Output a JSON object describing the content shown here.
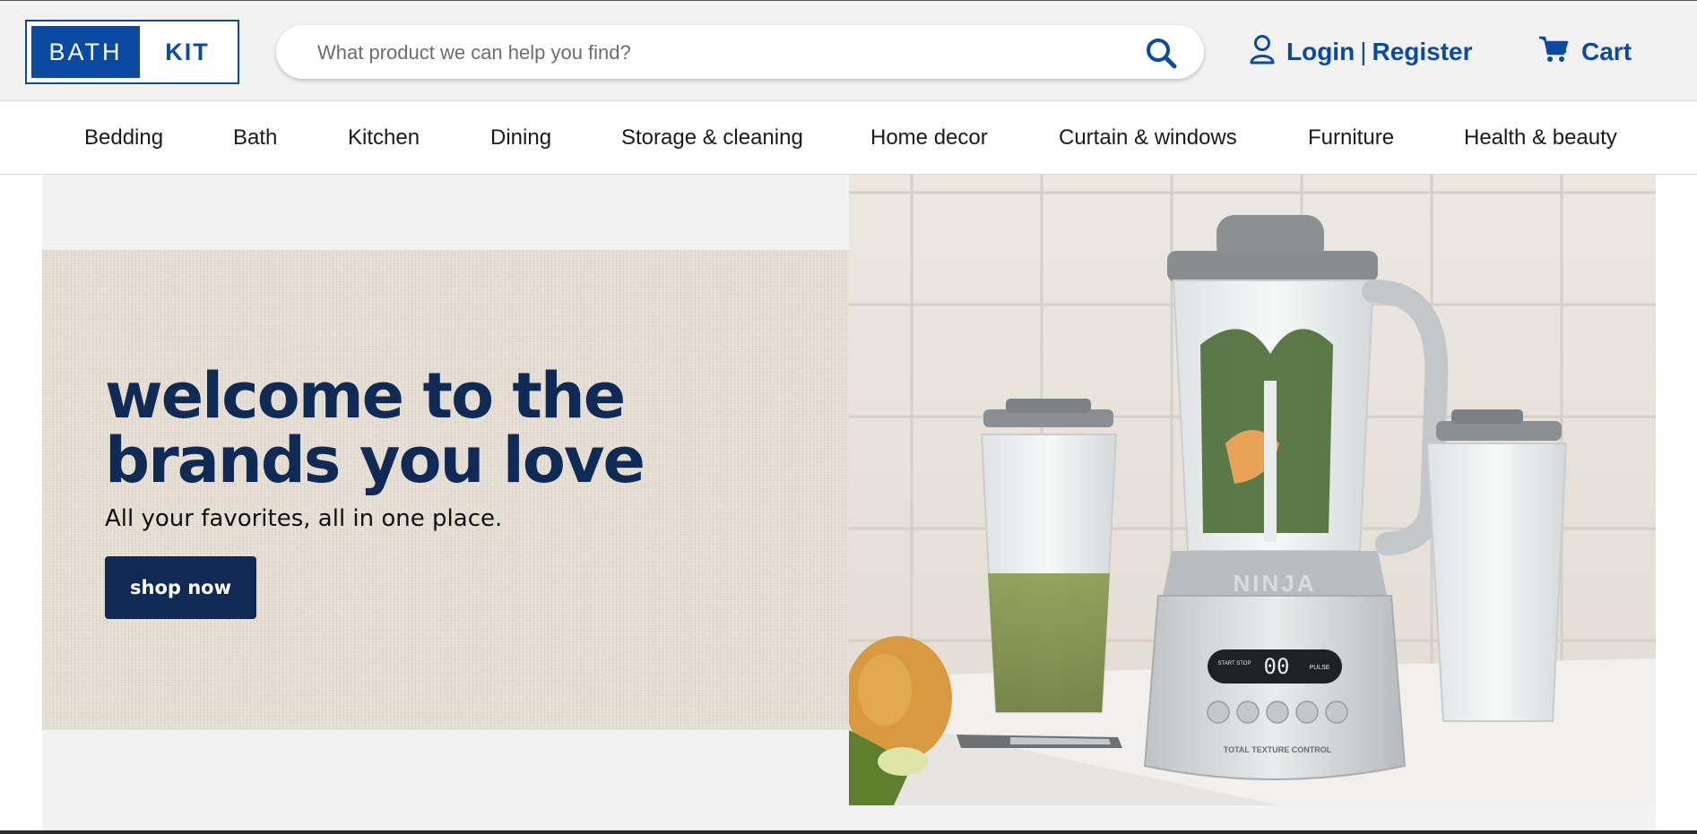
{
  "brand": {
    "part1": "BATH",
    "part2": "KIT"
  },
  "search": {
    "placeholder": "What product we can help you find?",
    "icon": "search-icon"
  },
  "account": {
    "login": "Login",
    "separator": "|",
    "register": "Register",
    "icon": "user-icon"
  },
  "cart": {
    "label": "Cart",
    "icon": "cart-icon"
  },
  "nav": {
    "items": [
      {
        "label": "Bedding"
      },
      {
        "label": "Bath"
      },
      {
        "label": "Kitchen"
      },
      {
        "label": "Dining"
      },
      {
        "label": "Storage & cleaning"
      },
      {
        "label": "Home decor"
      },
      {
        "label": "Curtain & windows"
      },
      {
        "label": "Furniture"
      },
      {
        "label": "Health & beauty"
      }
    ]
  },
  "hero": {
    "title_line1": "welcome to the",
    "title_line2": "brands you love",
    "subtitle": "All your favorites, all in one place.",
    "cta": "shop now",
    "image": {
      "brand_mark": "NINJA",
      "display": "00",
      "start_stop": "START STOP",
      "pulse": "PULSE",
      "footer_text": "TOTAL TEXTURE CONTROL"
    }
  },
  "colors": {
    "brand_blue": "#0b4aa2",
    "navy": "#0e2a55",
    "header_bg": "#f2f2f2",
    "linen": "#e5ddd1"
  }
}
